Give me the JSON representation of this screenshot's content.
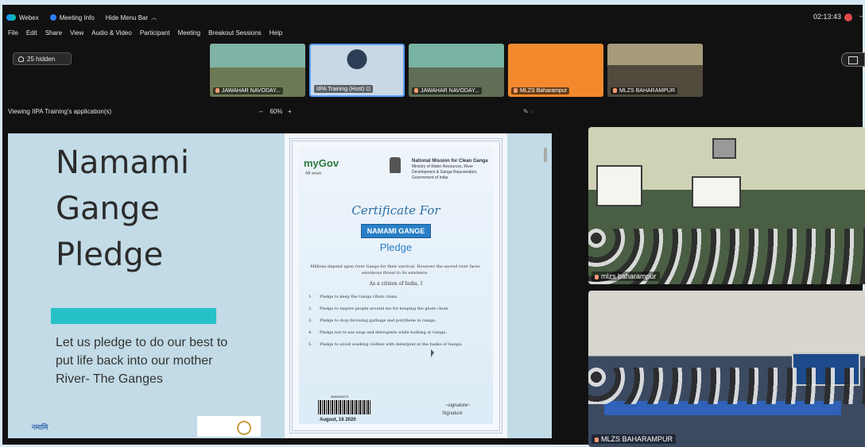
{
  "topbar": {
    "app": "Webex",
    "meeting_info": "Meeting Info",
    "hide_menu": "Hide Menu Bar",
    "clock": "02:13:43",
    "minimize": "–"
  },
  "menu": [
    "File",
    "Edit",
    "Share",
    "View",
    "Audio & Video",
    "Participant",
    "Meeting",
    "Breakout Sessions",
    "Help"
  ],
  "participants": {
    "hidden_label": "25 hidden",
    "thumbs": [
      {
        "name": "JAWAHAR NAVODAY..."
      },
      {
        "name": "IIPA Training (Host)"
      },
      {
        "name": "JAWAHAR NAVODAY..."
      },
      {
        "name": "MLZS Baharampur"
      },
      {
        "name": "MLZS BAHARAMPUR"
      }
    ]
  },
  "share": {
    "viewing": "Viewing IIPA Training's application(s)",
    "zoom_minus": "–",
    "zoom_level": "60%",
    "zoom_plus": "+"
  },
  "slide": {
    "title": "Namami\nGange\nPledge",
    "body": "Let us pledge to do our best to put life back into our mother River- The Ganges",
    "logo": "नमामि"
  },
  "certificate": {
    "mygov": "myGov",
    "mygov_sub": "मेरी सरकार",
    "org": "National Mission for Clean Ganga",
    "org_sub": "Ministry of Water Resources, River Development & Ganga Rejuvenation, Government of India",
    "script_title": "Certificate For",
    "banner": "NAMAMI GANGE",
    "pledge_word": "Pledge",
    "intro": "Millions depend upon river Ganga for their survival. However the sacred river faces enormous threat to its existence.",
    "citizen": "As a citizen of India, I",
    "items": [
      "Pledge to keep the Ganga Ghats clean.",
      "Pledge to inspire people around me for keeping the ghats clean.",
      "Pledge to stop throwing garbage and polythene in Ganga.",
      "Pledge not to use soap and detergents while bathing at Ganga.",
      "Pledge to avoid washing clothes with detergent at the banks of Ganga."
    ],
    "barcode_number": "4669256273",
    "date": "August, 16 2020",
    "signature": "Signature"
  },
  "videos": [
    {
      "label": "mlzs baharampur"
    },
    {
      "label": "MLZS BAHARAMPUR"
    }
  ]
}
